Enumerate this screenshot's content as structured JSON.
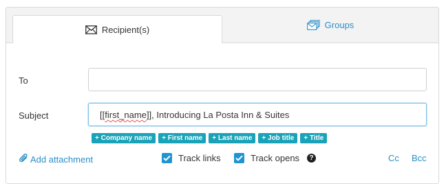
{
  "tabs": {
    "recipients": {
      "label": "Recipient(s)",
      "icon": "envelope-icon"
    },
    "groups": {
      "label": "Groups",
      "icon": "stacked-envelopes-icon"
    }
  },
  "form": {
    "to": {
      "label": "To",
      "value": ""
    },
    "subject": {
      "label": "Subject",
      "value_prefix": "[[",
      "value_misspelled": "first_name",
      "value_suffix": "]], Introducing La Posta Inn & Suites"
    }
  },
  "tokens": [
    "+ Company name",
    "+ First name",
    "+ Last name",
    "+ Job title",
    "+ Title"
  ],
  "footer": {
    "add_attachment": "Add attachment",
    "track_links": "Track links",
    "track_links_checked": true,
    "track_opens": "Track opens",
    "track_opens_checked": true,
    "help": "?",
    "cc": "Cc",
    "bcc": "Bcc"
  },
  "colors": {
    "accent": "#2b8fc7",
    "token_bg": "#1aa3b8",
    "checkbox": "#1f94d2",
    "focus_border": "#7bc0e6"
  }
}
